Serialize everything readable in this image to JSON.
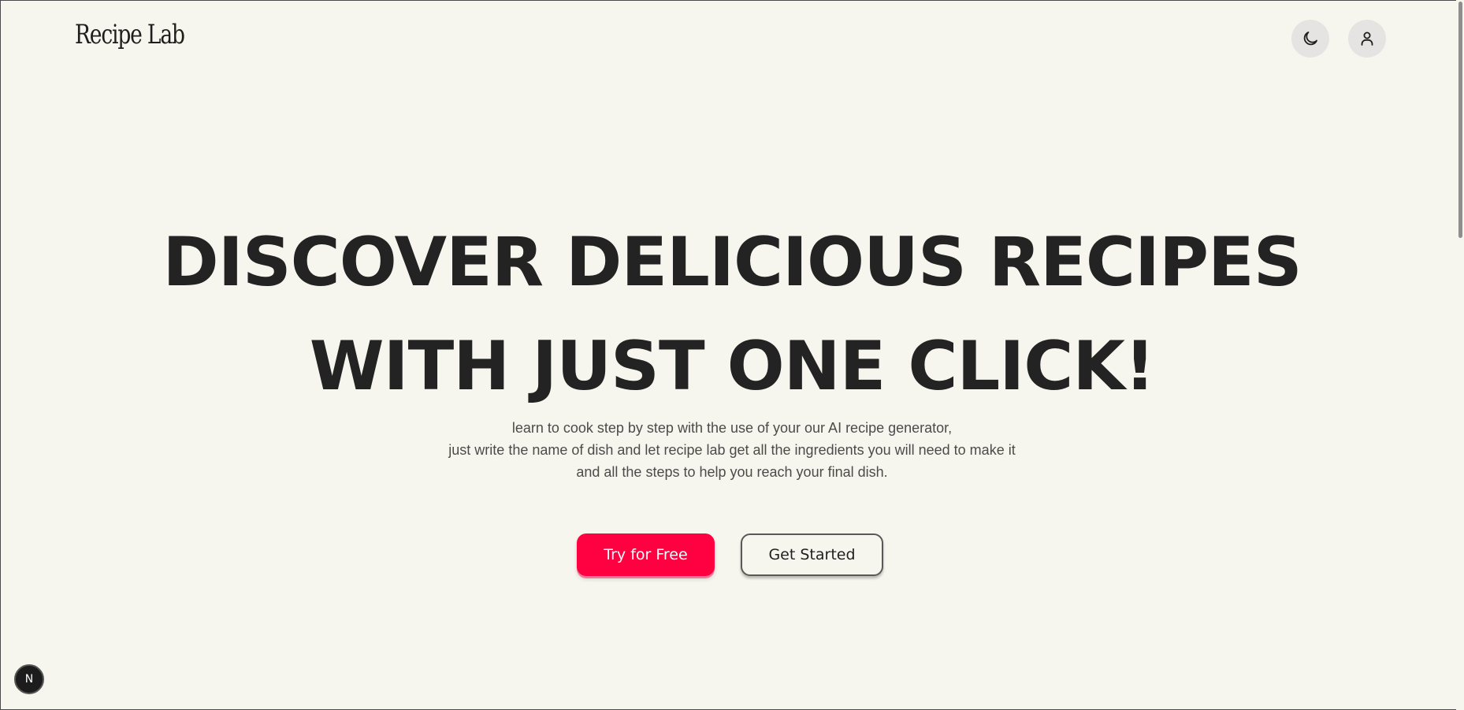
{
  "header": {
    "logo_text": "Recipe Lab",
    "theme_toggle_icon": "moon-icon",
    "account_icon": "user-icon"
  },
  "hero": {
    "title_line_1": "DISCOVER DELICIOUS RECIPES",
    "title_line_2": "WITH JUST ONE CLICK!",
    "subtitle_line_1": "learn to cook step by step with the use of your our AI recipe generator,",
    "subtitle_line_2": "just write the name of dish and let recipe lab get all the ingredients you will need to make it",
    "subtitle_line_3": "and all the steps to help you reach your final dish."
  },
  "actions": {
    "try_free_label": "Try for Free",
    "get_started_label": "Get Started"
  },
  "dev_badge": {
    "label": "N"
  },
  "colors": {
    "background": "#f7f6ee",
    "primary": "#ff0040",
    "text": "#232323",
    "icon_button_bg": "#e5e4e3"
  }
}
